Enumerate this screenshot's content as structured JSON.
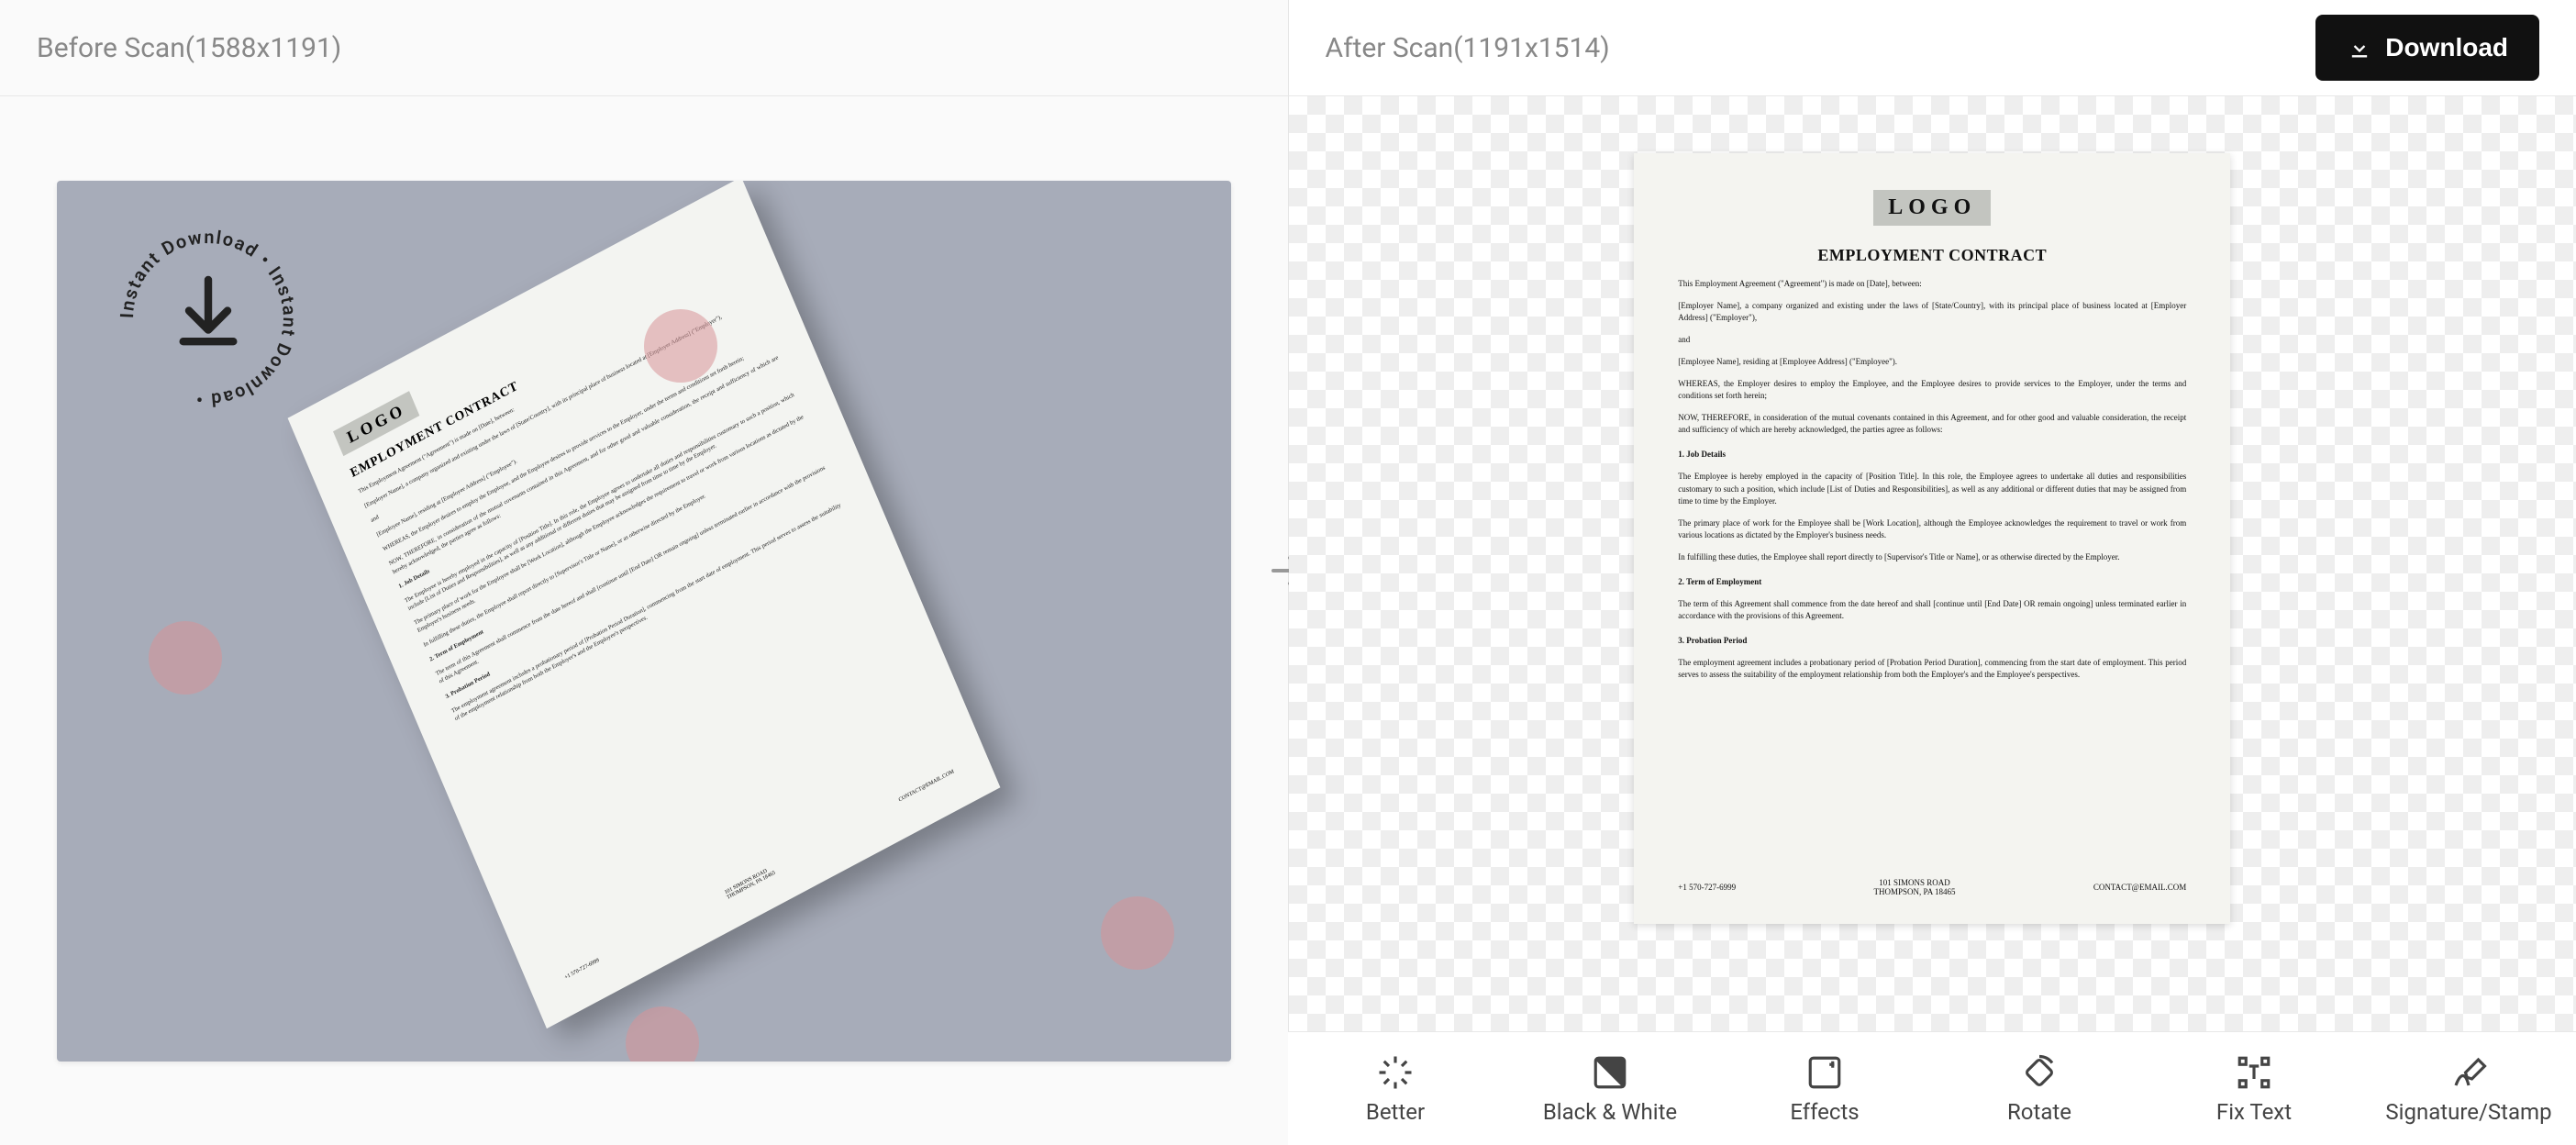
{
  "left": {
    "title": "Before Scan(1588x1191)",
    "badge_text": "Instant Download • Instant Download •"
  },
  "right": {
    "title": "After Scan(1191x1514)",
    "download_label": "Download"
  },
  "doc": {
    "logo": "LOGO",
    "heading": "EMPLOYMENT CONTRACT",
    "intro": "This Employment Agreement (\"Agreement\") is made on [Date], between:",
    "employer": "[Employer Name], a company organized and existing under the laws of [State/Country], with its principal place of business located at [Employer Address] (\"Employer\"),",
    "and": "and",
    "employee": "[Employee Name], residing at [Employee Address] (\"Employee\").",
    "whereas": "WHEREAS, the Employer desires to employ the Employee, and the Employee desires to provide services to the Employer, under the terms and conditions set forth herein;",
    "therefore": "NOW, THEREFORE, in consideration of the mutual covenants contained in this Agreement, and for other good and valuable consideration, the receipt and sufficiency of which are hereby acknowledged, the parties agree as follows:",
    "s1_title": "1. Job Details",
    "s1_p1": "The Employee is hereby employed in the capacity of [Position Title]. In this role, the Employee agrees to undertake all duties and responsibilities customary to such a position, which include [List of Duties and Responsibilities], as well as any additional or different duties that may be assigned from time to time by the Employer.",
    "s1_p2": "The primary place of work for the Employee shall be [Work Location], although the Employee acknowledges the requirement to travel or work from various locations as dictated by the Employer's business needs.",
    "s1_p3": "In fulfilling these duties, the Employee shall report directly to [Supervisor's Title or Name], or as otherwise directed by the Employer.",
    "s2_title": "2. Term of Employment",
    "s2_p1": "The term of this Agreement shall commence from the date hereof and shall [continue until [End Date] OR remain ongoing] unless terminated earlier in accordance with the provisions of this Agreement.",
    "s3_title": "3. Probation Period",
    "s3_p1": "The employment agreement includes a probationary period of [Probation Period Duration], commencing from the start date of employment. This period serves to assess the suitability of the employment relationship from both the Employer's and the Employee's perspectives.",
    "footer_phone": "+1 570-727-6999",
    "footer_addr1": "101 SIMONS ROAD",
    "footer_addr2": "THOMPSON, PA 18465",
    "footer_email": "CONTACT@EMAIL.COM"
  },
  "tools": [
    {
      "label": "Better"
    },
    {
      "label": "Black & White"
    },
    {
      "label": "Effects"
    },
    {
      "label": "Rotate"
    },
    {
      "label": "Fix Text"
    },
    {
      "label": "Signature/Stamp"
    }
  ]
}
